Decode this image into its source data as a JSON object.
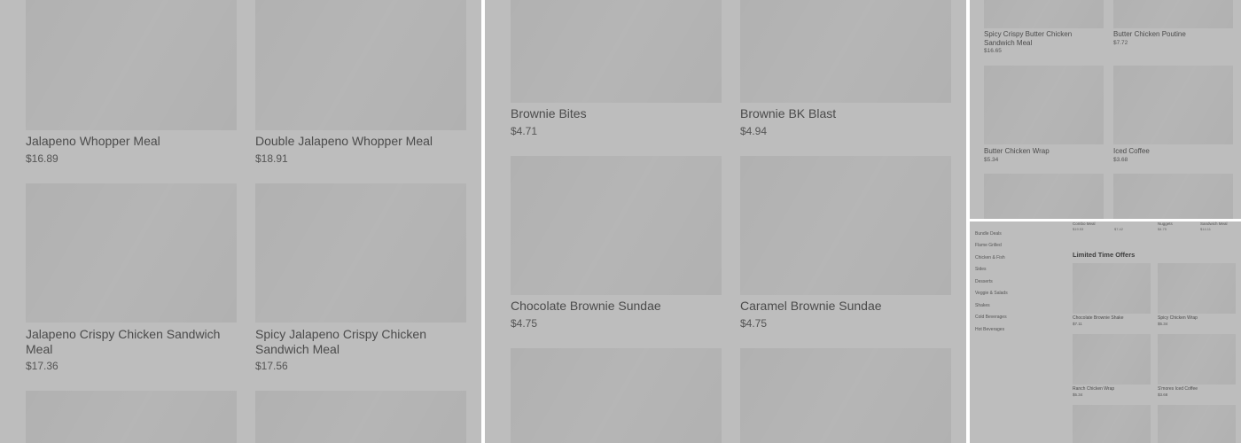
{
  "panelA": {
    "items": [
      {
        "name": "Jalapeno Whopper Meal",
        "price": "$16.89"
      },
      {
        "name": "Double Jalapeno Whopper Meal",
        "price": "$18.91"
      },
      {
        "name": "Jalapeno Crispy Chicken Sandwich Meal",
        "price": "$17.36"
      },
      {
        "name": "Spicy Jalapeno Crispy Chicken Sandwich Meal",
        "price": "$17.56"
      }
    ]
  },
  "panelB": {
    "items": [
      {
        "name": "Brownie Bites",
        "price": "$4.71"
      },
      {
        "name": "Brownie BK Blast",
        "price": "$4.94"
      },
      {
        "name": "Chocolate Brownie Sundae",
        "price": "$4.75"
      },
      {
        "name": "Caramel Brownie Sundae",
        "price": "$4.75"
      }
    ]
  },
  "panelC": {
    "items": [
      {
        "name": "Spicy Crispy Butter Chicken Sandwich Meal",
        "price": "$16.65"
      },
      {
        "name": "Butter Chicken Poutine",
        "price": "$7.72"
      },
      {
        "name": "Butter Chicken Wrap",
        "price": "$5.34"
      },
      {
        "name": "Iced Coffee",
        "price": "$3.68"
      }
    ]
  },
  "panelD": {
    "categories": [
      "Bundle Deals",
      "Flame Grilled",
      "Chicken & Fish",
      "Sides",
      "Desserts",
      "Veggie & Salads",
      "Shakes",
      "Cold Beverages",
      "Hot Beverages"
    ],
    "top_items": [
      {
        "name": "Combo Meal",
        "price": "$19.53"
      },
      {
        "name": "",
        "price": "$7.42"
      },
      {
        "name": "Nuggets",
        "price": "$4.75"
      },
      {
        "name": "Sandwich Meal",
        "price": "$14.11"
      }
    ],
    "section_title": "Limited Time Offers",
    "items": [
      {
        "name": "Chocolate Brownie Shake",
        "price": "$7.11"
      },
      {
        "name": "Spicy Chicken Wrap",
        "price": "$5.34"
      },
      {
        "name": "Ranch Chicken Wrap",
        "price": "$5.34"
      },
      {
        "name": "S'mores Iced Coffee",
        "price": "$3.68"
      }
    ]
  }
}
